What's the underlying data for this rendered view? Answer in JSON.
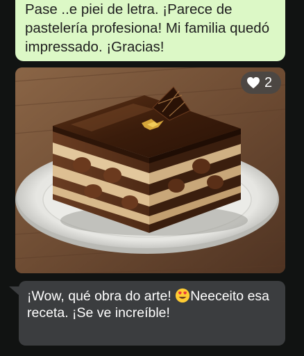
{
  "outgoing_message": {
    "text": "Pase ..e piei de letra. ¡Parece de pastelería profesiona! Mi familia quedó impressado. ¡Gracias!"
  },
  "image_message": {
    "image": "chocolate-opera-cake-photo",
    "reaction": {
      "icon": "heart-icon",
      "count": "2"
    }
  },
  "incoming_message": {
    "text_part1": "¡Wow, qué obra do arte! ",
    "emoji": "heart-eyes-emoji",
    "text_part2": "Neeceito esa receta. ¡Se ve increíble!"
  },
  "colors": {
    "outgoing_bubble": "#dcf8c6",
    "incoming_bubble": "#3b3d3f",
    "background": "#111312"
  }
}
